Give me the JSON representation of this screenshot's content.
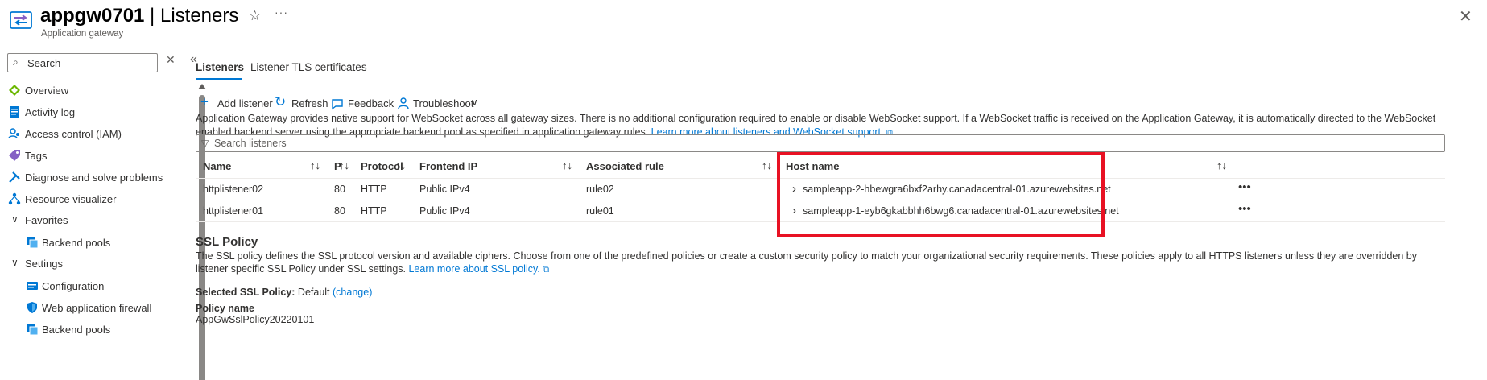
{
  "header": {
    "resource_name": "appgw0701",
    "separator": " | ",
    "blade_title": "Listeners",
    "subtitle": "Application gateway",
    "icons": {
      "resource": "application-gateway-icon",
      "favorite": "star-icon",
      "more": "more-icon",
      "close": "close-icon"
    }
  },
  "sidebar": {
    "search_placeholder": "Search",
    "items": [
      {
        "label": "Overview",
        "icon": "overview-icon",
        "color": "#6bb700"
      },
      {
        "label": "Activity log",
        "icon": "activity-log-icon",
        "color": "#0078d4"
      },
      {
        "label": "Access control (IAM)",
        "icon": "iam-icon",
        "color": "#0078d4"
      },
      {
        "label": "Tags",
        "icon": "tag-icon",
        "color": "#8661c5"
      },
      {
        "label": "Diagnose and solve problems",
        "icon": "wrench-icon",
        "color": "#0078d4"
      },
      {
        "label": "Resource visualizer",
        "icon": "visualizer-icon",
        "color": "#0078d4"
      },
      {
        "label": "Favorites",
        "group": true
      },
      {
        "label": "Backend pools",
        "icon": "backend-pool-icon",
        "color": "#0078d4",
        "indent": true
      },
      {
        "label": "Settings",
        "group": true
      },
      {
        "label": "Configuration",
        "icon": "configuration-icon",
        "color": "#0078d4",
        "indent": true
      },
      {
        "label": "Web application firewall",
        "icon": "shield-icon",
        "color": "#0078d4",
        "indent": true
      },
      {
        "label": "Backend pools",
        "icon": "backend-pool-icon",
        "color": "#0078d4",
        "indent": true
      }
    ]
  },
  "tabs": [
    {
      "label": "Listeners",
      "active": true
    },
    {
      "label": "Listener TLS certificates",
      "active": false
    }
  ],
  "toolbar": {
    "add_listener": "Add listener",
    "refresh": "Refresh",
    "feedback": "Feedback",
    "troubleshoot": "Troubleshoot"
  },
  "info": {
    "text": "Application Gateway provides native support for WebSocket across all gateway sizes. There is no additional configuration required to enable or disable WebSocket support. If a WebSocket traffic is received on the Application Gateway, it is automatically directed to the WebSocket enabled backend server using the appropriate backend pool as specified in application gateway rules. ",
    "link": "Learn more about listeners and WebSocket support."
  },
  "filter_placeholder": "Search listeners",
  "table": {
    "columns": [
      "Name",
      "Port",
      "Protocol",
      "Frontend IP",
      "Associated rule",
      "Host name"
    ],
    "port_header_visible": "P",
    "rows": [
      {
        "name": "httplistener02",
        "port": "80",
        "protocol": "HTTP",
        "frontend_ip": "Public IPv4",
        "rule": "rule02",
        "host": "sampleapp-2-hbewgra6bxf2arhy.canadacentral-01.azurewebsites.net"
      },
      {
        "name": "httplistener01",
        "port": "80",
        "protocol": "HTTP",
        "frontend_ip": "Public IPv4",
        "rule": "rule01",
        "host": "sampleapp-1-eyb6gkabbhh6bwg6.canadacentral-01.azurewebsites.net"
      }
    ]
  },
  "ssl": {
    "title": "SSL Policy",
    "description": "The SSL policy defines the SSL protocol version and available ciphers. Choose from one of the predefined policies or create a custom security policy to match your organizational security requirements. These policies apply to all HTTPS listeners unless they are overridden by listener specific SSL Policy under SSL settings. ",
    "link": "Learn more about SSL policy.",
    "selected_label": "Selected SSL Policy:",
    "selected_value": "Default",
    "change_link": "(change)",
    "policy_name_label": "Policy name",
    "policy_name_value": "AppGwSslPolicy20220101"
  },
  "colors": {
    "accent": "#0078d4",
    "highlight_box": "#e81123"
  }
}
